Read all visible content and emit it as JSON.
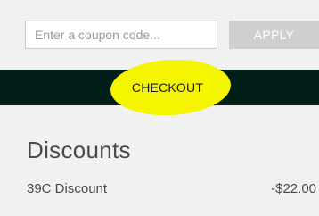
{
  "coupon": {
    "placeholder": "Enter a coupon code...",
    "value": "",
    "apply_label": "APPLY"
  },
  "checkout": {
    "label": "CHECKOUT",
    "highlight_color": "#f5f500",
    "bar_color": "#021e18"
  },
  "discounts": {
    "title": "Discounts",
    "items": [
      {
        "name": "39C Discount",
        "amount": "-$22.00"
      }
    ]
  }
}
